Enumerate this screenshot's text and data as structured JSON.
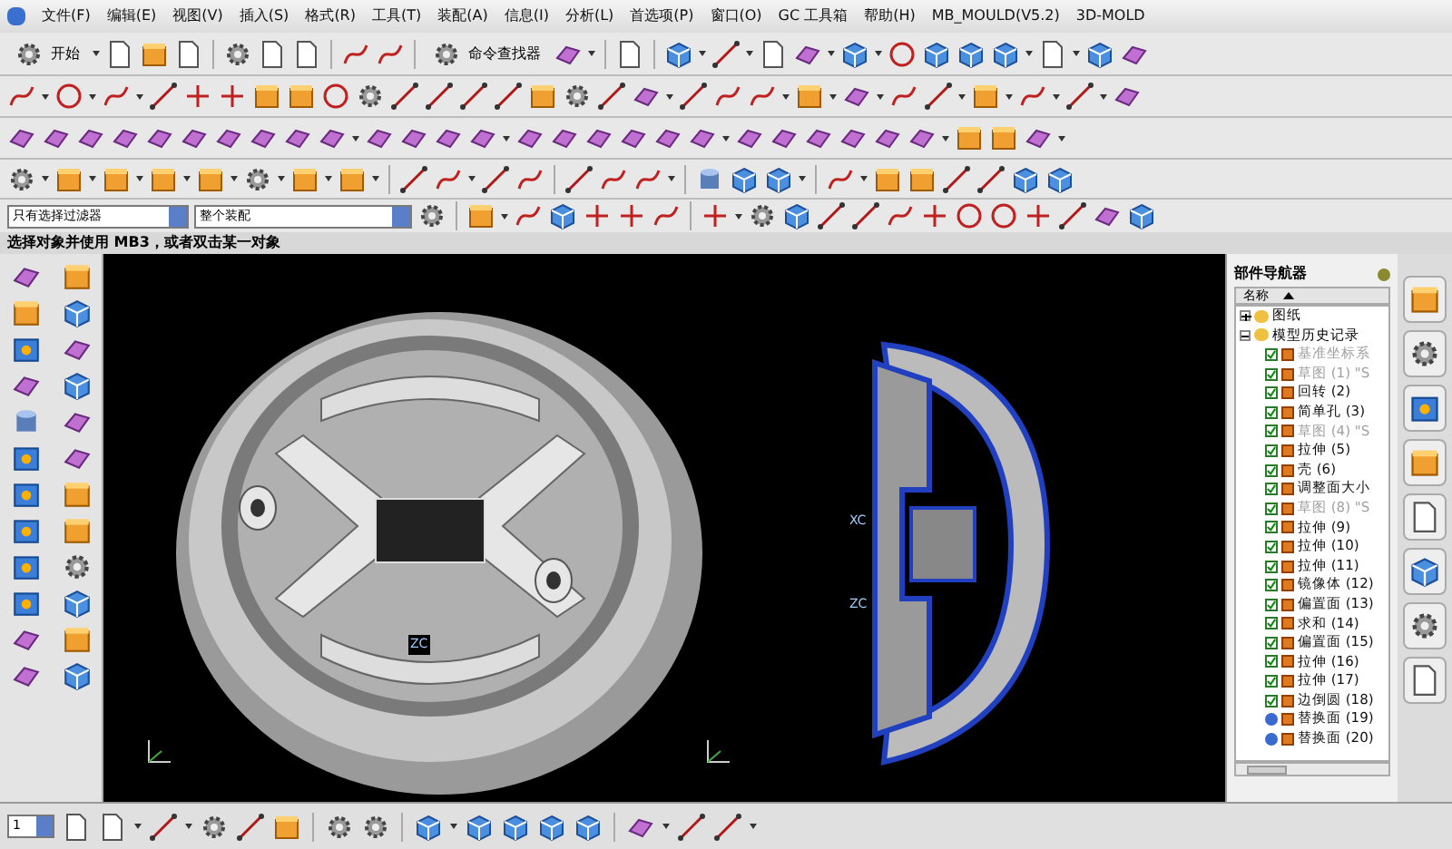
{
  "menu_bar": {
    "items": [
      "文件(F)",
      "编辑(E)",
      "视图(V)",
      "插入(S)",
      "格式(R)",
      "工具(T)",
      "装配(A)",
      "信息(I)",
      "分析(L)",
      "首选项(P)",
      "窗口(O)",
      "GC 工具箱",
      "帮助(H)",
      "MB_MOULD(V5.2)",
      "3D-MOLD"
    ]
  },
  "toolbar": {
    "start_label": "开始",
    "command_finder_label": "命令查找器"
  },
  "selection_bar": {
    "filter": "只有选择过滤器",
    "scope": "整个装配"
  },
  "prompt": "选择对象并使用 MB3，或者双击某一对象",
  "viewport": {
    "axis_labels": [
      {
        "text": "ZC",
        "kind": "left"
      },
      {
        "text": "XC",
        "kind": "right_x"
      },
      {
        "text": "ZC",
        "kind": "right_z"
      }
    ]
  },
  "part_navigator": {
    "title": "部件导航器",
    "column": "名称",
    "tree": [
      {
        "label": "图纸",
        "expanded": false
      },
      {
        "label": "模型历史记录",
        "expanded": true,
        "children": [
          {
            "label": "基准坐标系",
            "kind": "checked",
            "dimmed": true
          },
          {
            "label": "草图 (1) \"S",
            "kind": "checked",
            "dimmed": true
          },
          {
            "label": "回转 (2)",
            "kind": "checked",
            "dimmed": false
          },
          {
            "label": "简单孔 (3)",
            "kind": "checked",
            "dimmed": false
          },
          {
            "label": "草图 (4) \"S",
            "kind": "checked",
            "dimmed": true
          },
          {
            "label": "拉伸 (5)",
            "kind": "checked",
            "dimmed": false
          },
          {
            "label": "壳 (6)",
            "kind": "checked",
            "dimmed": false
          },
          {
            "label": "调整面大小",
            "kind": "checked",
            "dimmed": false
          },
          {
            "label": "草图 (8) \"S",
            "kind": "checked",
            "dimmed": true
          },
          {
            "label": "拉伸 (9)",
            "kind": "checked",
            "dimmed": false
          },
          {
            "label": "拉伸 (10)",
            "kind": "checked",
            "dimmed": false
          },
          {
            "label": "拉伸 (11)",
            "kind": "checked",
            "dimmed": false
          },
          {
            "label": "镜像体 (12)",
            "kind": "checked",
            "dimmed": false
          },
          {
            "label": "偏置面 (13)",
            "kind": "checked",
            "dimmed": false
          },
          {
            "label": "求和 (14)",
            "kind": "checked",
            "dimmed": false
          },
          {
            "label": "偏置面 (15)",
            "kind": "checked",
            "dimmed": false
          },
          {
            "label": "拉伸 (16)",
            "kind": "checked",
            "dimmed": false
          },
          {
            "label": "拉伸 (17)",
            "kind": "checked",
            "dimmed": false
          },
          {
            "label": "边倒圆 (18)",
            "kind": "checked",
            "dimmed": false
          },
          {
            "label": "替换面 (19)",
            "kind": "warning",
            "dimmed": false
          },
          {
            "label": "替换面 (20)",
            "kind": "warning",
            "dimmed": false
          }
        ]
      }
    ]
  },
  "bottom_bar": {
    "layer": "1"
  }
}
